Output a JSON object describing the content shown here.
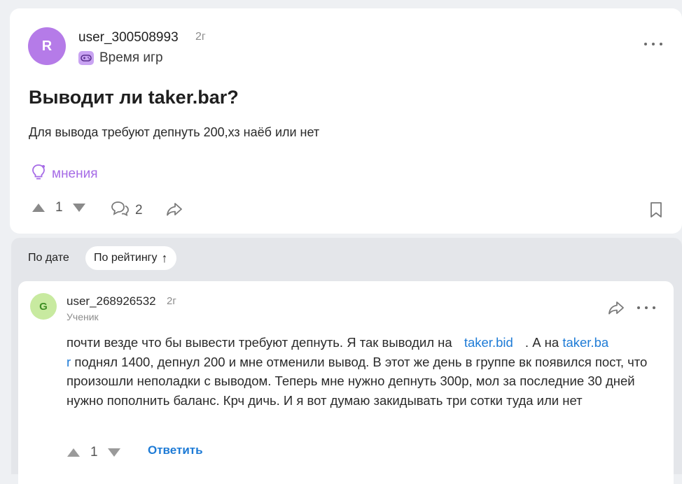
{
  "post": {
    "avatar_letter": "R",
    "username": "user_300508993",
    "time": "2г",
    "subject": "Время игр",
    "title": "Выводит ли taker.bar?",
    "body": "Для вывода требуют депнуть 200,хз наёб или нет",
    "opinions_label": "мнения",
    "votes": "1",
    "comments_count": "2"
  },
  "sort": {
    "by_date": "По дате",
    "by_rating": "По рейтингу",
    "rating_arrow": "↑"
  },
  "comment": {
    "avatar_letter": "G",
    "username": "user_268926532",
    "time": "2г",
    "role": "Ученик",
    "text_part1": "почти везде что бы вывести требуют депнуть. Я так выводил на",
    "link1": "taker.bid",
    "text_part2": ". А на",
    "link2_line1": "taker.ba",
    "link2_line2": "r",
    "text_part3": "поднял 1400, депнул 200 и мне отменили вывод. В этот же день в группе вк появился пост, что произошли неполадки с выводом. Теперь мне нужно депнуть 300р, мол за последние 30 дней нужно пополнить баланс. Крч дичь. И я вот думаю закидывать три сотки туда или нет",
    "votes": "1",
    "reply_label": "Ответить"
  },
  "colors": {
    "accent_purple": "#a66be6",
    "link_blue": "#1e7bd6",
    "post_avatar": "#b57be8",
    "comment_avatar": "#c8eaa0"
  },
  "icons": [
    "gamepad-icon",
    "lightbulb-icon",
    "comment-bubble-icon",
    "share-icon",
    "bookmark-icon",
    "more-icon",
    "upvote-icon",
    "downvote-icon"
  ]
}
